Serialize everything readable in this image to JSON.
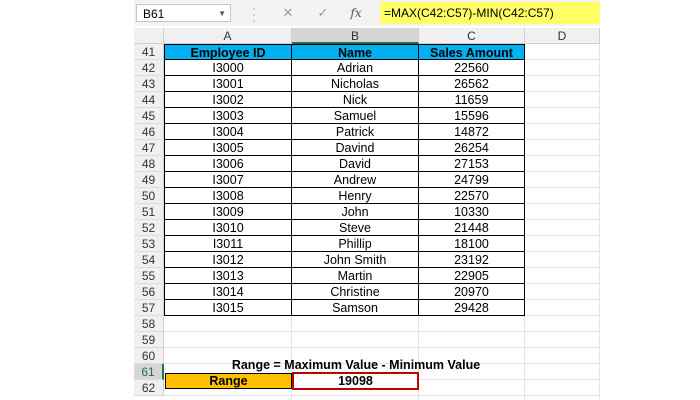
{
  "formula_bar": {
    "name_box": "B61",
    "formula": "=MAX(C42:C57)-MIN(C42:C57)",
    "fx_symbol": "fx",
    "cancel_symbol": "✕",
    "enter_symbol": "✓"
  },
  "columns": [
    "A",
    "B",
    "C",
    "D"
  ],
  "active_column": "B",
  "active_row": "61",
  "row_numbers": [
    "41",
    "42",
    "43",
    "44",
    "45",
    "46",
    "47",
    "48",
    "49",
    "50",
    "51",
    "52",
    "53",
    "54",
    "55",
    "56",
    "57",
    "58",
    "59",
    "60",
    "61",
    "62"
  ],
  "table": {
    "headers": [
      "Employee ID",
      "Name",
      "Sales Amount"
    ],
    "header_color": "#00b0f0",
    "rows": [
      [
        "I3000",
        "Adrian",
        "22560"
      ],
      [
        "I3001",
        "Nicholas",
        "26562"
      ],
      [
        "I3002",
        "Nick",
        "11659"
      ],
      [
        "I3003",
        "Samuel",
        "15596"
      ],
      [
        "I3004",
        "Patrick",
        "14872"
      ],
      [
        "I3005",
        "Davind",
        "26254"
      ],
      [
        "I3006",
        "David",
        "27153"
      ],
      [
        "I3007",
        "Andrew",
        "24799"
      ],
      [
        "I3008",
        "Henry",
        "22570"
      ],
      [
        "I3009",
        "John",
        "10330"
      ],
      [
        "I3010",
        "Steve",
        "21448"
      ],
      [
        "I3011",
        "Phillip",
        "18100"
      ],
      [
        "I3012",
        "John Smith",
        "23192"
      ],
      [
        "I3013",
        "Martin",
        "22905"
      ],
      [
        "I3014",
        "Christine",
        "20970"
      ],
      [
        "I3015",
        "Samson",
        "29428"
      ]
    ]
  },
  "note": "Range = Maximum Value - Minimum Value",
  "range": {
    "label": "Range",
    "value": "19098",
    "label_color": "#ffc000",
    "value_border_color": "#c00000"
  }
}
